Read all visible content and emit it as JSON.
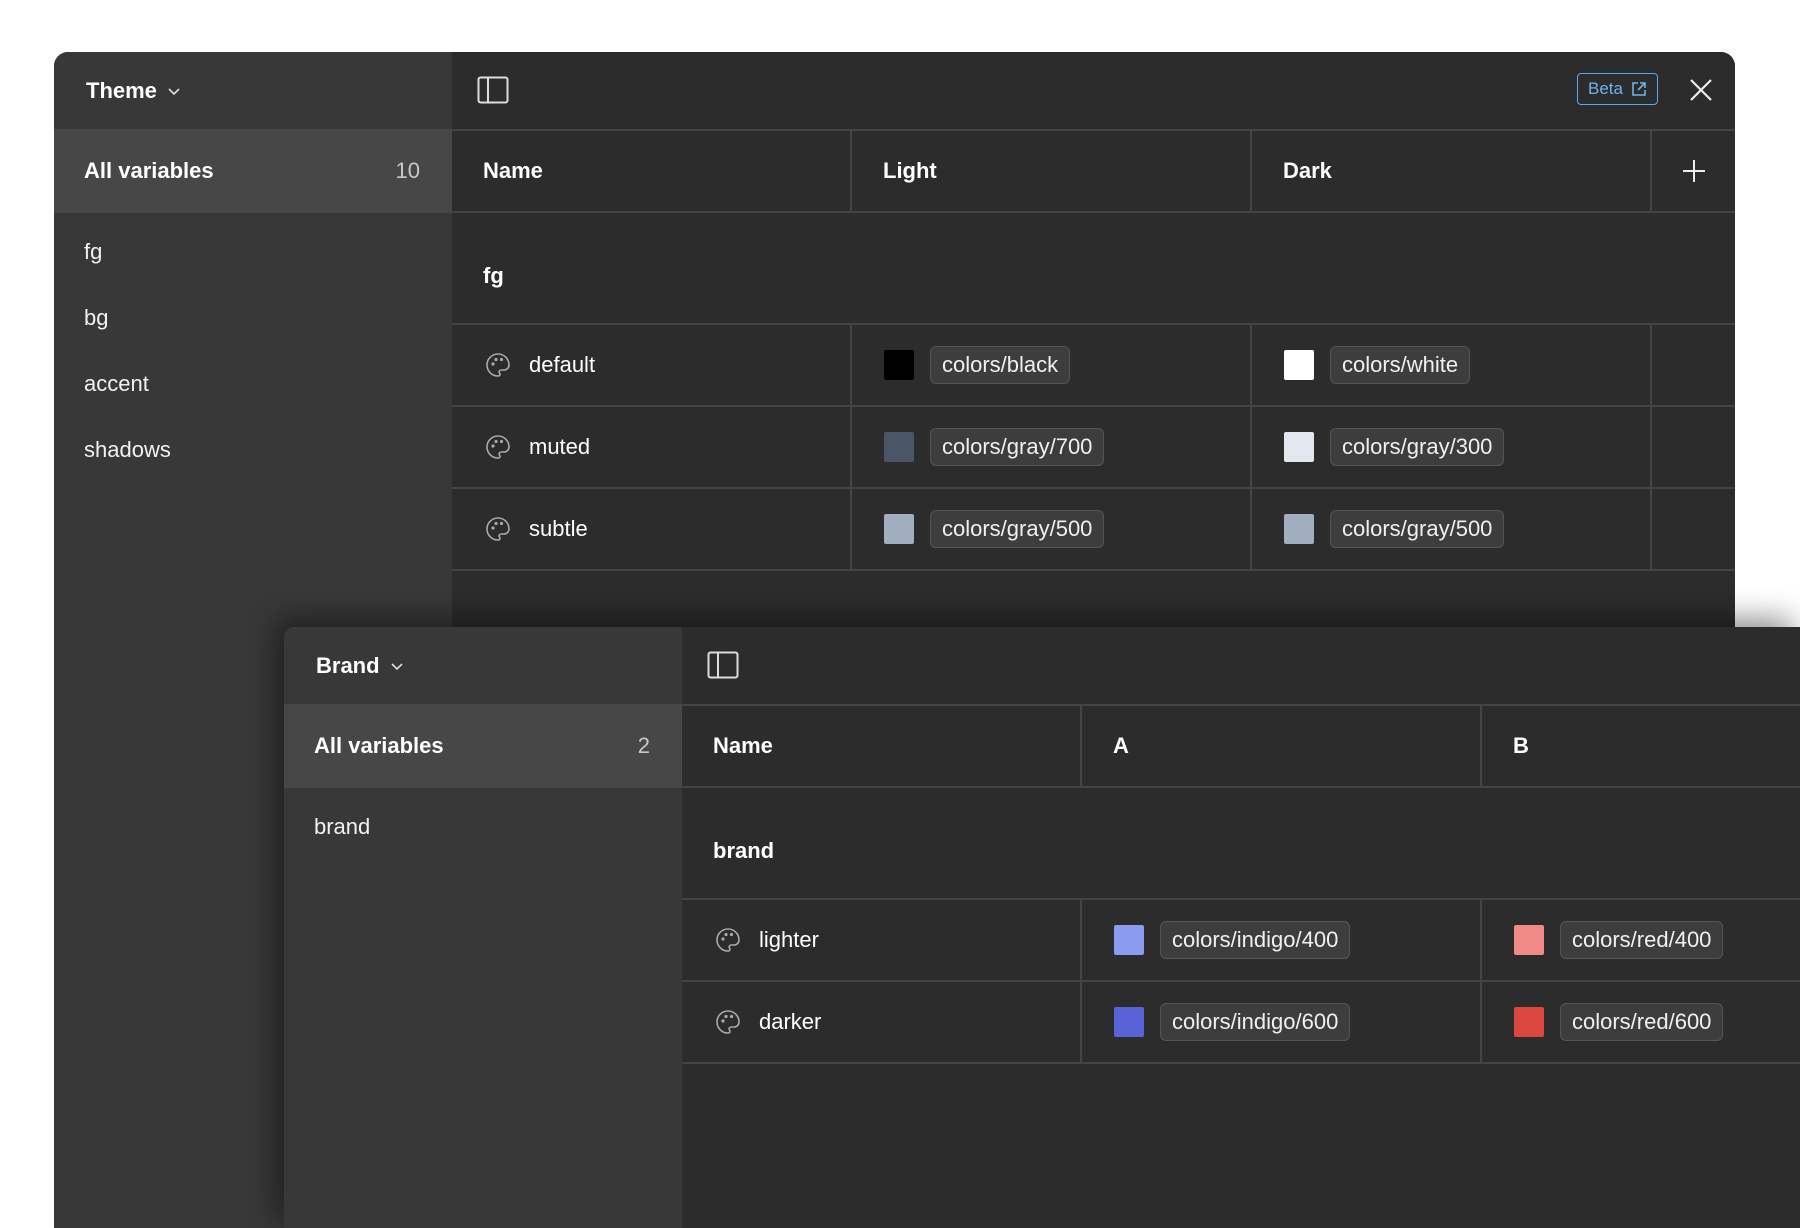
{
  "theme": {
    "collection_name": "Theme",
    "all_variables_label": "All variables",
    "all_variables_count": "10",
    "groups": [
      "fg",
      "bg",
      "accent",
      "shadows"
    ],
    "beta_label": "Beta",
    "columns": [
      "Name",
      "Light",
      "Dark"
    ],
    "section": "fg",
    "rows": [
      {
        "name": "default",
        "light": {
          "label": "colors/black",
          "color": "#000000"
        },
        "dark": {
          "label": "colors/white",
          "color": "#ffffff"
        }
      },
      {
        "name": "muted",
        "light": {
          "label": "colors/gray/700",
          "color": "#4a5568"
        },
        "dark": {
          "label": "colors/gray/300",
          "color": "#e2e8f0"
        }
      },
      {
        "name": "subtle",
        "light": {
          "label": "colors/gray/500",
          "color": "#a0aec0"
        },
        "dark": {
          "label": "colors/gray/500",
          "color": "#a0aec0"
        }
      }
    ]
  },
  "brand": {
    "collection_name": "Brand",
    "all_variables_label": "All variables",
    "all_variables_count": "2",
    "groups": [
      "brand"
    ],
    "columns": [
      "Name",
      "A",
      "B"
    ],
    "section": "brand",
    "rows": [
      {
        "name": "lighter",
        "a": {
          "label": "colors/indigo/400",
          "color": "#8b9cf0"
        },
        "b": {
          "label": "colors/red/400",
          "color": "#f08a86"
        }
      },
      {
        "name": "darker",
        "a": {
          "label": "colors/indigo/600",
          "color": "#5a62d8"
        },
        "b": {
          "label": "colors/red/600",
          "color": "#d9473f"
        }
      }
    ]
  }
}
